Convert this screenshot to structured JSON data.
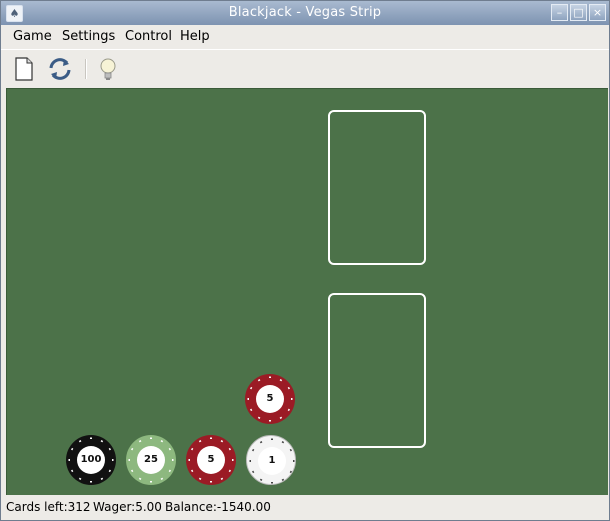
{
  "window": {
    "title": "Blackjack - Vegas Strip"
  },
  "menu": [
    {
      "label": "Game"
    },
    {
      "label": "Settings"
    },
    {
      "label": "Control"
    },
    {
      "label": "Help"
    }
  ],
  "toolbar": {
    "icons": [
      "new-game-icon",
      "restart-icon",
      "hint-icon"
    ]
  },
  "table": {
    "felt_color": "#4c7249",
    "card_slots": [
      "dealer-hand",
      "player-hand"
    ],
    "bet_chip": {
      "value": "5",
      "color": "#9b1b25"
    },
    "chips": [
      {
        "value": "100",
        "color": "#111111"
      },
      {
        "value": "25",
        "color": "#8db87f"
      },
      {
        "value": "5",
        "color": "#9b1b25"
      },
      {
        "value": "1",
        "color": "#f4f4f4"
      }
    ]
  },
  "status": {
    "cards_left": "Cards left:312",
    "wager": "Wager:5.00",
    "balance": "Balance:-1540.00"
  }
}
